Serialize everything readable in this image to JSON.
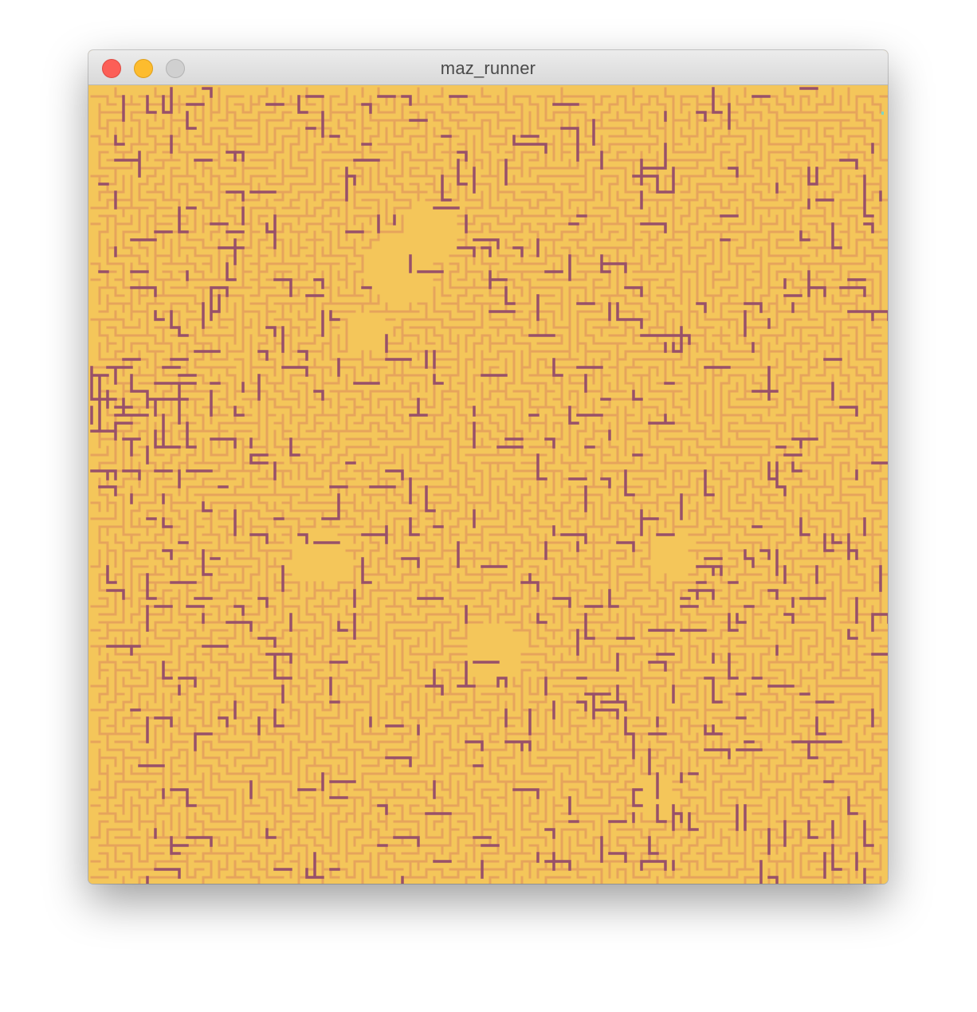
{
  "window": {
    "title": "maz_runner"
  },
  "controls": {
    "close": "close-icon",
    "minimize": "minimize-icon",
    "zoom": "zoom-icon"
  },
  "maze": {
    "background_color": "#f4c65a",
    "wall_color": "#e6a45c",
    "path_color": "#98506a",
    "accent_color": "#7fd6c2"
  }
}
